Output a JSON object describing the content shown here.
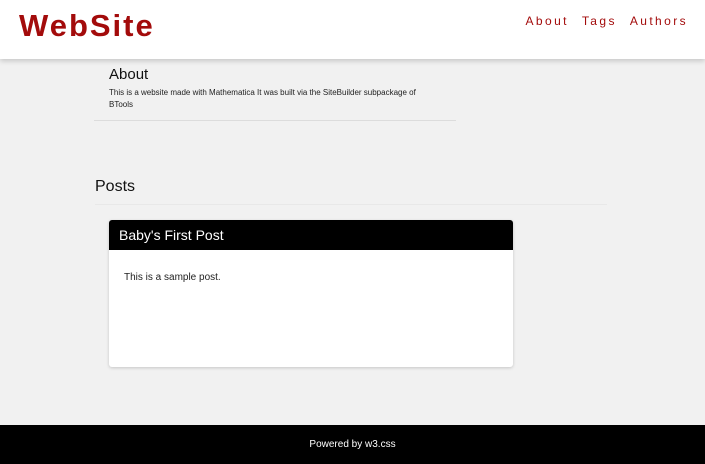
{
  "header": {
    "site_title": "WebSite",
    "nav": [
      "About",
      "Tags",
      "Authors"
    ]
  },
  "about": {
    "heading": "About",
    "text": "This is a website made with Mathematica It was built via the SiteBuilder subpackage of BTools"
  },
  "posts": {
    "heading": "Posts",
    "items": [
      {
        "title": "Baby's First Post",
        "body": "This is a sample post."
      }
    ]
  },
  "footer": {
    "text": "Powered by w3.css"
  },
  "colors": {
    "brand": "#a30b0b",
    "background": "#f1f1f1",
    "card_header": "#000000",
    "footer": "#000000"
  }
}
